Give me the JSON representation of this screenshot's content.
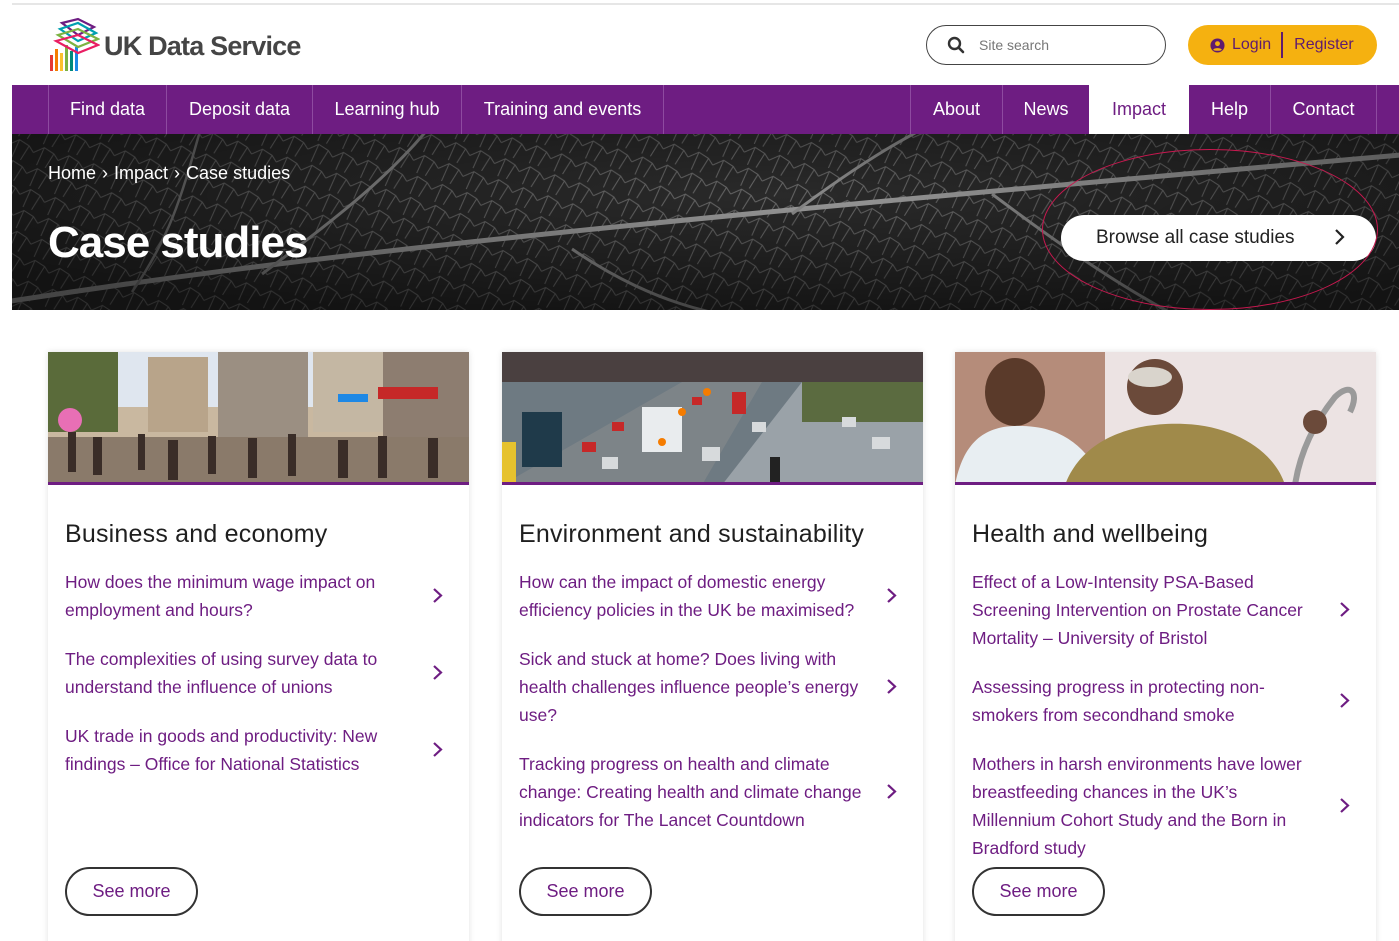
{
  "brand": {
    "name": "UK Data Service",
    "accent": "#6e1d82",
    "highlight": "#f5b110",
    "annotation": "#c7184f"
  },
  "search": {
    "placeholder": "Site search"
  },
  "auth": {
    "login_label": "Login",
    "register_label": "Register"
  },
  "nav": {
    "left": [
      {
        "label": "Find data"
      },
      {
        "label": "Deposit data"
      },
      {
        "label": "Learning hub"
      },
      {
        "label": "Training and events"
      }
    ],
    "right": [
      {
        "label": "About"
      },
      {
        "label": "News"
      },
      {
        "label": "Impact",
        "active": true
      },
      {
        "label": "Help"
      },
      {
        "label": "Contact"
      }
    ]
  },
  "breadcrumb": {
    "home": "Home",
    "sep": "›",
    "impact": "Impact",
    "current": "Case studies"
  },
  "hero": {
    "title": "Case studies",
    "browse_label": "Browse all case studies"
  },
  "cards": [
    {
      "title": "Business and economy",
      "links": [
        "How does the minimum wage impact on employment and hours?",
        "The complexities of using survey data to understand the influence of unions",
        "UK trade in goods and productivity: New findings – Office for National Statistics"
      ],
      "see_more": "See more"
    },
    {
      "title": "Environment and sustainability",
      "links": [
        "How can the impact of domestic energy efficiency policies in the UK be maximised?",
        "Sick and stuck at home? Does living with health challenges influence people’s energy use?",
        "Tracking progress on health and climate change: Creating health and climate change indicators for The Lancet Countdown"
      ],
      "see_more": "See more"
    },
    {
      "title": "Health and wellbeing",
      "links": [
        "Effect of a Low-Intensity PSA-Based Screening Intervention on Prostate Cancer Mortality – University of Bristol",
        "Assessing progress in protecting non-smokers from secondhand smoke",
        "Mothers in harsh environments have lower breastfeeding chances in the UK’s Millennium Cohort Study and the Born in Bradford study"
      ],
      "see_more": "See more"
    }
  ]
}
